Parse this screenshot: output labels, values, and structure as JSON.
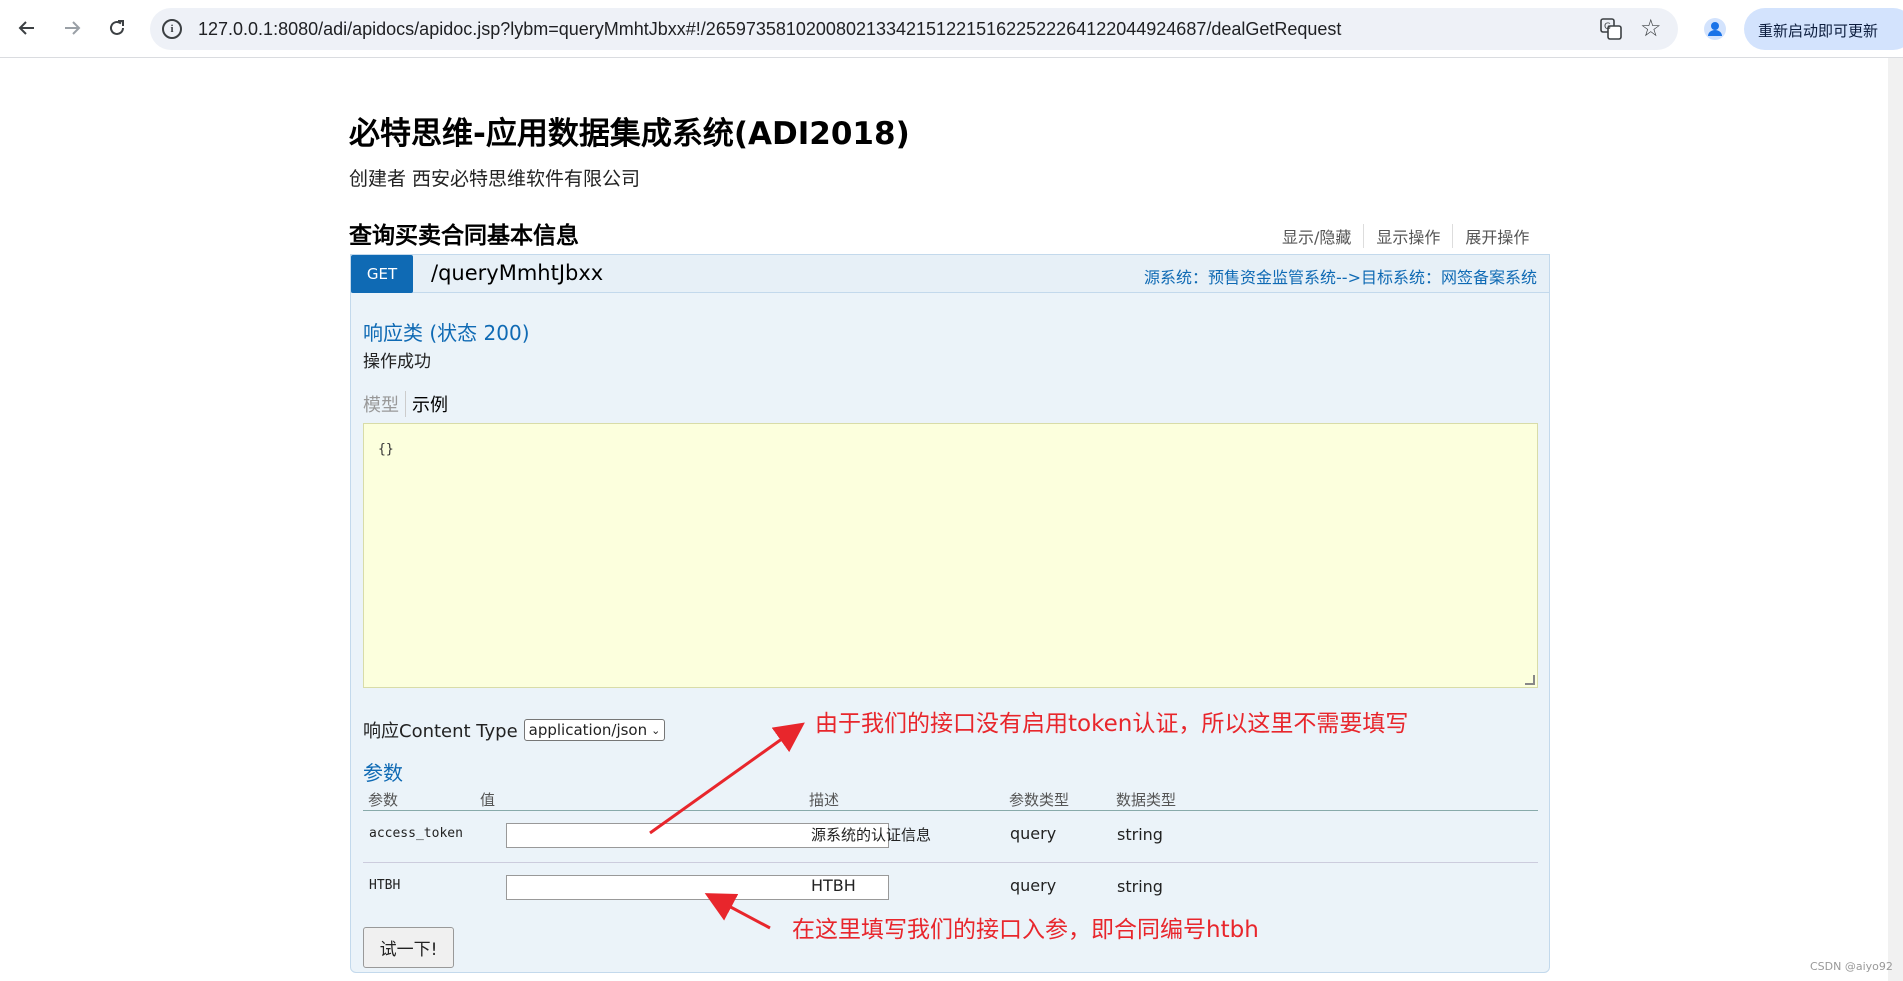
{
  "browser": {
    "url": "127.0.0.1:8080/adi/apidocs/apidoc.jsp?lybm=queryMmhtJbxx#!/26597358102008021334215122151622522264122044924687/dealGetRequest",
    "update_label": "重新启动即可更新"
  },
  "page": {
    "title": "必特思维-应用数据集成系统(ADI2018)",
    "creator": "创建者 西安必特思维软件有限公司"
  },
  "section": {
    "title": "查询买卖合同基本信息",
    "links": [
      "显示/隐藏",
      "显示操作",
      "展开操作"
    ]
  },
  "operation": {
    "method": "GET",
    "path": "/queryMmhtJbxx",
    "flow": "源系统：预售资金监管系统-->目标系统：网签备案系统",
    "response_class": "响应类 (状态 200)",
    "response_desc": "操作成功",
    "tab_model": "模型",
    "tab_example": "示例",
    "example_body": "{}",
    "content_type_label": "响应Content Type",
    "content_type_value": "application/json",
    "params_title": "参数",
    "params_headers": [
      "参数",
      "值",
      "描述",
      "参数类型",
      "数据类型"
    ],
    "params": [
      {
        "name": "access_token",
        "value": "",
        "desc": "源系统的认证信息",
        "param_type": "query",
        "data_type": "string"
      },
      {
        "name": "HTBH",
        "value": "",
        "desc": "HTBH",
        "param_type": "query",
        "data_type": "string"
      }
    ],
    "try_label": "试一下!"
  },
  "annotations": {
    "top": "由于我们的接口没有启用token认证，所以这里不需要填写",
    "bottom": "在这里填写我们的接口入参，即合同编号htbh"
  },
  "watermark": "CSDN @aiyo92",
  "colors": {
    "method_bg": "#0f6ab4",
    "annotation": "#e8262c",
    "example_bg": "#fcffdd",
    "op_bg": "#ebf3f9"
  }
}
